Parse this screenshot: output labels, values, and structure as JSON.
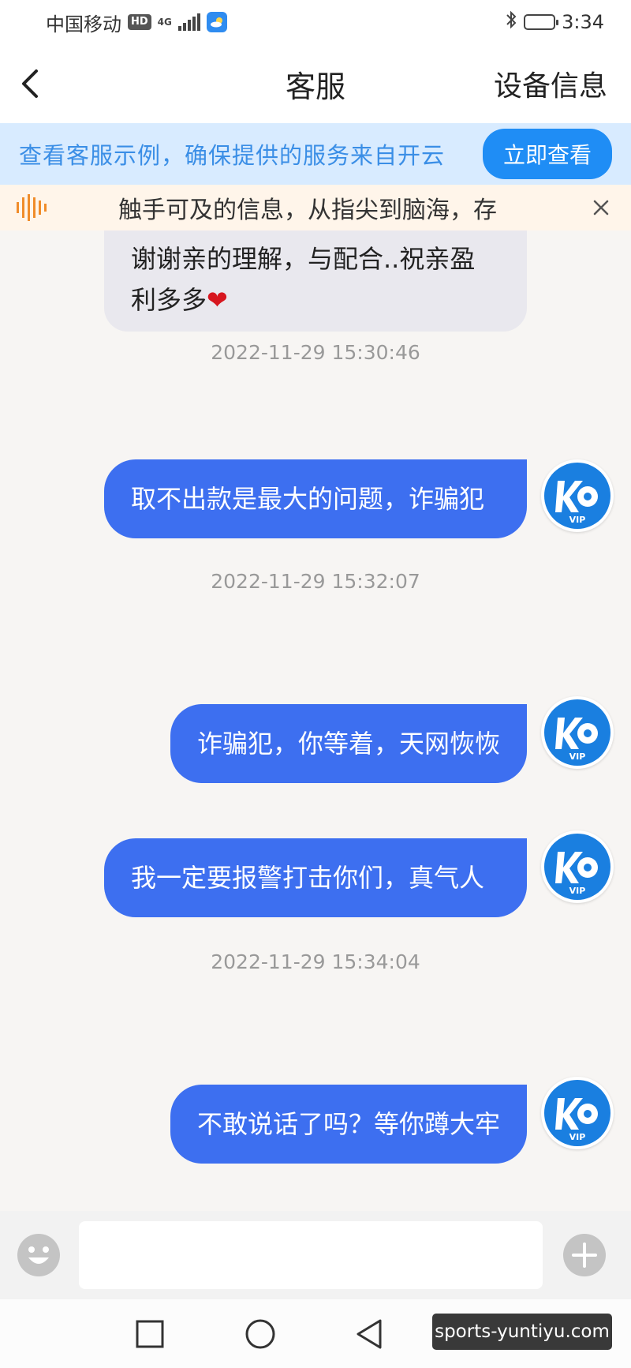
{
  "status_bar": {
    "carrier": "中国移动",
    "hd": "HD",
    "network": "4G",
    "time": "3:34"
  },
  "header": {
    "title": "客服",
    "right_action": "设备信息",
    "back_icon": "chevron-left-icon"
  },
  "notice": {
    "text": "查看客服示例，确保提供的服务来自开云",
    "button": "立即查看",
    "bg_color": "#d8ebff",
    "accent": "#1f8df5"
  },
  "marquee": {
    "text": "触手可及的信息，从指尖到脑海，存",
    "close": "×"
  },
  "messages": {
    "incoming_1": {
      "text": "谢谢亲的理解，与配合..祝亲盈利多多",
      "emoji": "❤"
    },
    "ts_1": "2022-11-29 15:30:46",
    "out_1": "取不出款是最大的问题，诈骗犯",
    "ts_2": "2022-11-29 15:32:07",
    "out_2": "诈骗犯，你等着，天网恢恢",
    "out_3": "我一定要报警打击你们，真气人",
    "ts_3": "2022-11-29 15:34:04",
    "out_4": "不敢说话了吗？等你蹲大牢"
  },
  "avatar": {
    "label": "VIP",
    "color": "#1a7fe0"
  },
  "input": {
    "placeholder": ""
  },
  "watermark": "sports-yuntiyu.com",
  "colors": {
    "outgoing_bubble": "#3d6ff0",
    "incoming_bubble": "#e9e8ee"
  }
}
